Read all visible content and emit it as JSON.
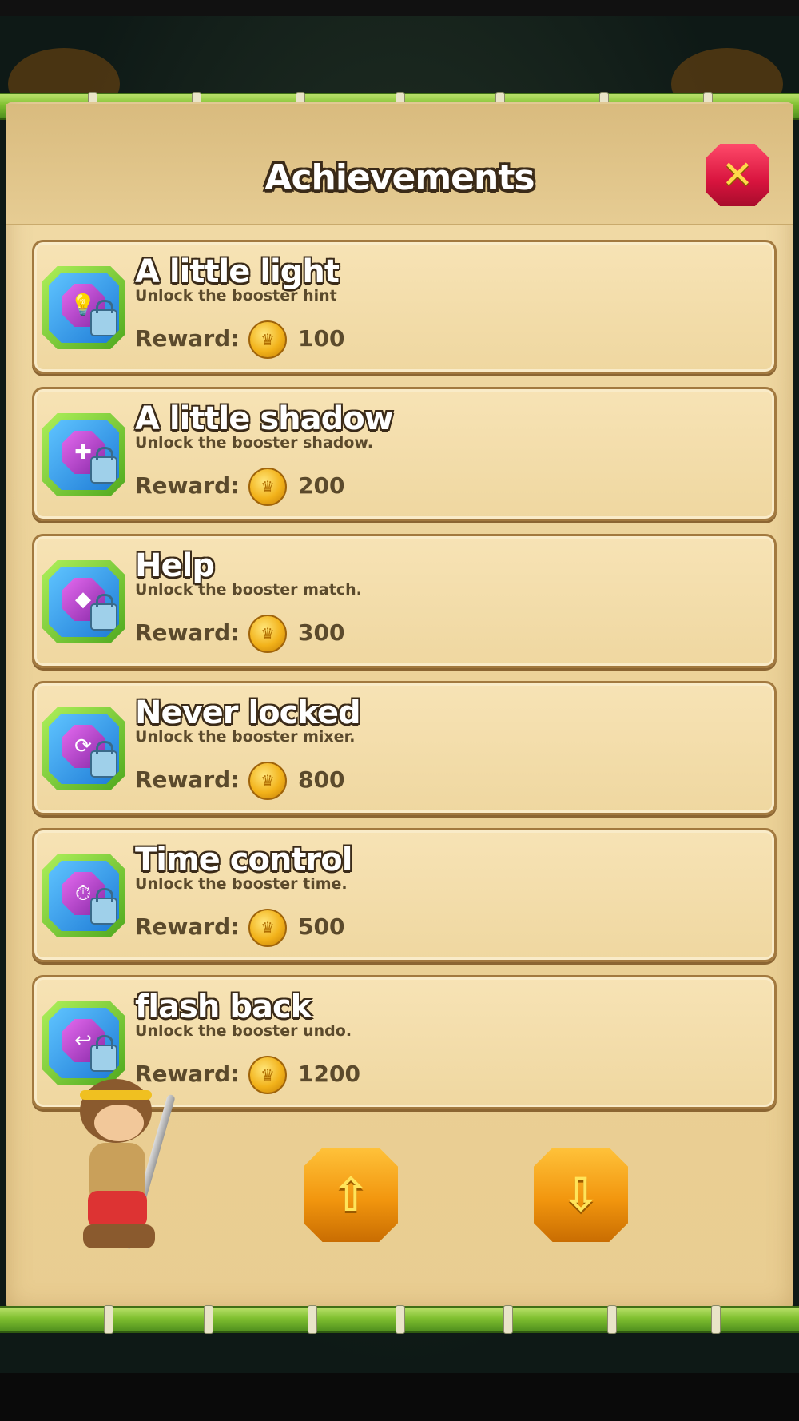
{
  "screen": {
    "title": "Achievements",
    "close_icon": "close-icon"
  },
  "achievements": [
    {
      "title": "A little light",
      "description": "Unlock the booster hint",
      "reward_label": "Reward:",
      "reward": "100",
      "icon": "lightbulb-icon",
      "glyph": "💡"
    },
    {
      "title": "A little shadow",
      "description": "Unlock the booster shadow.",
      "reward_label": "Reward:",
      "reward": "200",
      "icon": "shadow-icon",
      "glyph": "✚"
    },
    {
      "title": "Help",
      "description": "Unlock the booster match.",
      "reward_label": "Reward:",
      "reward": "300",
      "icon": "match-icon",
      "glyph": "◆"
    },
    {
      "title": "Never locked",
      "description": "Unlock the booster mixer.",
      "reward_label": "Reward:",
      "reward": "800",
      "icon": "mixer-icon",
      "glyph": "⟳"
    },
    {
      "title": "Time control",
      "description": "Unlock the booster time.",
      "reward_label": "Reward:",
      "reward": "500",
      "icon": "clock-icon",
      "glyph": "⏱"
    },
    {
      "title": "flash back",
      "description": "Unlock the booster undo.",
      "reward_label": "Reward:",
      "reward": "1200",
      "icon": "undo-icon",
      "glyph": "↩"
    }
  ],
  "navigation": {
    "up_icon": "arrow-up-icon",
    "down_icon": "arrow-down-icon"
  },
  "colors": {
    "panel": "#efd7a0",
    "close_button": "#d8143e",
    "arrow_button": "#f2960e",
    "bamboo": "#7fbf2f"
  }
}
